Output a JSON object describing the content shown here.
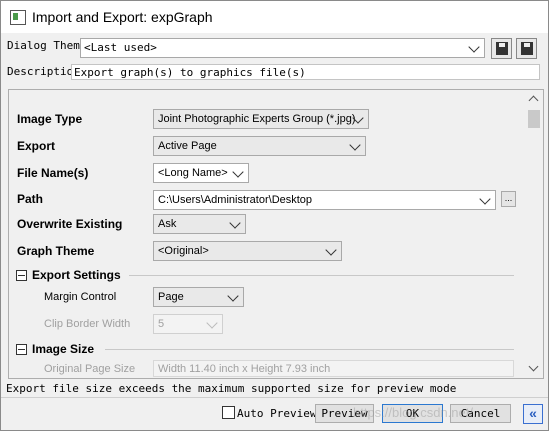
{
  "window": {
    "title": "Import and Export: expGraph"
  },
  "dialog_theme": {
    "label": "Dialog Theme",
    "value": "<Last used>"
  },
  "description": {
    "label": "Description",
    "value": "Export graph(s) to graphics file(s)"
  },
  "fields": {
    "image_type": {
      "label": "Image Type",
      "value": "Joint Photographic Experts Group (*.jpg)"
    },
    "export": {
      "label": "Export",
      "value": "Active Page"
    },
    "file_name": {
      "label": "File Name(s)",
      "value": "<Long Name>"
    },
    "path": {
      "label": "Path",
      "value": "C:\\Users\\Administrator\\Desktop",
      "browse": "..."
    },
    "overwrite": {
      "label": "Overwrite Existing",
      "value": "Ask"
    },
    "graph_theme": {
      "label": "Graph Theme",
      "value": "<Original>"
    }
  },
  "export_settings": {
    "title": "Export Settings",
    "margin_control": {
      "label": "Margin Control",
      "value": "Page"
    },
    "clip_border_width": {
      "label": "Clip Border Width",
      "value": "5"
    }
  },
  "image_size": {
    "title": "Image Size",
    "original_page_size": {
      "label": "Original Page Size",
      "value": "Width 11.40 inch x Height 7.93 inch"
    }
  },
  "status_message": "Export file size exceeds the maximum supported size for preview mode",
  "footer": {
    "auto_preview": "Auto Preview",
    "preview": "Preview",
    "ok": "OK",
    "cancel": "Cancel",
    "collapse": "«"
  },
  "watermark": "https://blog.csdn.net/..."
}
